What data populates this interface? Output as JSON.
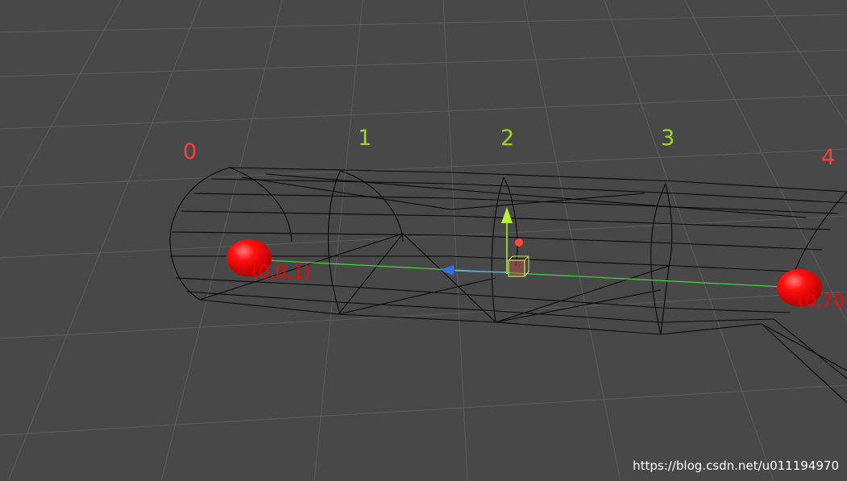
{
  "scene_view": {
    "background_color": "#484848",
    "grid_color": "#5a5a5a",
    "wire_color": "#0a0a0a"
  },
  "segment_labels": [
    {
      "text": "0",
      "color": "#ff3b3b"
    },
    {
      "text": "1",
      "color": "#a4d22a"
    },
    {
      "text": "2",
      "color": "#a4d22a"
    },
    {
      "text": "3",
      "color": "#a4d22a"
    },
    {
      "text": "4",
      "color": "#ff3b3b"
    }
  ],
  "control_points": {
    "start": {
      "label": "(0,0,1)",
      "color": "#ff0000"
    },
    "end": {
      "label": "(0,70",
      "color": "#ff0000"
    }
  },
  "spline_color": "#3fd63f",
  "gizmo": {
    "y_axis_color": "#b4f03a",
    "z_axis_color": "#3b6fe8",
    "pivot_color": "#ff4a3a",
    "box_color": "#c8e060"
  },
  "watermark": "https://blog.csdn.net/u011194970"
}
